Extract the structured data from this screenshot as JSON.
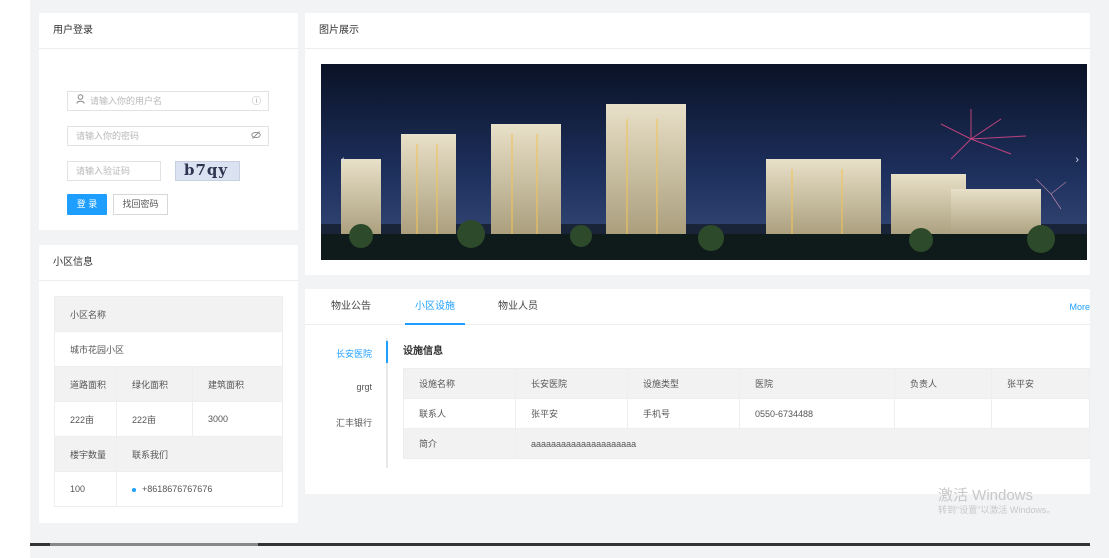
{
  "login": {
    "title": "用户登录",
    "username_placeholder": "请输入你的用户名",
    "password_placeholder": "请输入你的密码",
    "captcha_placeholder": "请输入验证码",
    "captcha_text": "b7qy",
    "login_label": "登 录",
    "forgot_label": "找回密码"
  },
  "community": {
    "title": "小区信息",
    "name_header": "小区名称",
    "name_value": "城市花园小区",
    "headers": [
      "道路面积",
      "绿化面积",
      "建筑面积"
    ],
    "values": [
      "222亩",
      "222亩",
      "3000"
    ],
    "headers2": [
      "楼宇数量",
      "联系我们"
    ],
    "values2": [
      "100",
      "+8618676767676"
    ]
  },
  "gallery": {
    "title": "图片展示",
    "prev": "‹",
    "next": "›"
  },
  "tabs": {
    "items": [
      "物业公告",
      "小区设施",
      "物业人员"
    ],
    "active": 1,
    "more": "More"
  },
  "facilities": {
    "list": [
      "长安医院",
      "grgt",
      "汇丰银行"
    ],
    "info_title": "设施信息",
    "rows": [
      [
        "设施名称",
        "长安医院",
        "设施类型",
        "医院",
        "负责人",
        "张平安"
      ],
      [
        "联系人",
        "张平安",
        "手机号",
        "0550-6734488",
        "",
        ""
      ],
      [
        "简介",
        "aaaaaaaaaaaaaaaaaaaaa"
      ]
    ]
  },
  "watermark": {
    "line1": "激活 Windows",
    "line2": "转到\"设置\"以激活 Windows。"
  },
  "colors": {
    "accent": "#1e9fff",
    "background": "#f2f3f5"
  }
}
